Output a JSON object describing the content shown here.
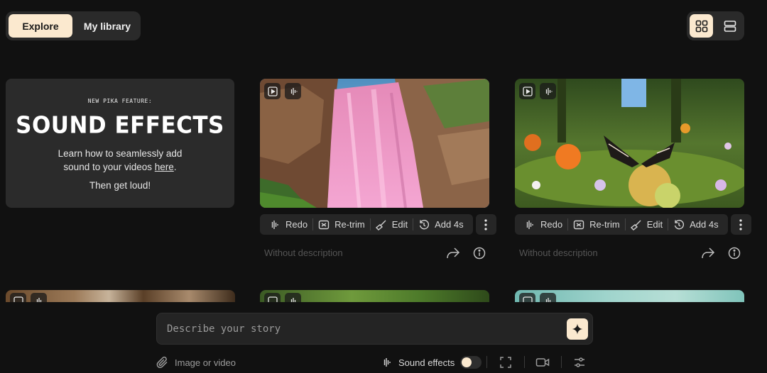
{
  "tabs": {
    "explore": "Explore",
    "library": "My library"
  },
  "view_toggle": {
    "grid_icon": "grid-icon",
    "list_icon": "rows-icon"
  },
  "promo": {
    "kicker": "NEW PIKA FEATURE:",
    "headline": "SOUND EFFECTS",
    "body_line1": "Learn how to seamlessly add",
    "body_line2_prefix": "sound to your videos ",
    "body_link": "here",
    "body_line2_suffix": ".",
    "cta": "Then get loud!"
  },
  "cards": [
    {
      "scene": "pink waterfall",
      "description": "Without description"
    },
    {
      "scene": "butterfly on flowers",
      "description": "Without description"
    }
  ],
  "actions": {
    "redo": "Redo",
    "retrim": "Re-trim",
    "edit": "Edit",
    "add": "Add 4s"
  },
  "prompt": {
    "placeholder": "Describe your story"
  },
  "bottom": {
    "attach": "Image or video",
    "sound": "Sound effects",
    "sound_enabled": false
  },
  "colors": {
    "accent": "#fbe9cf",
    "background": "#111111",
    "panel": "#2a2a2a"
  }
}
